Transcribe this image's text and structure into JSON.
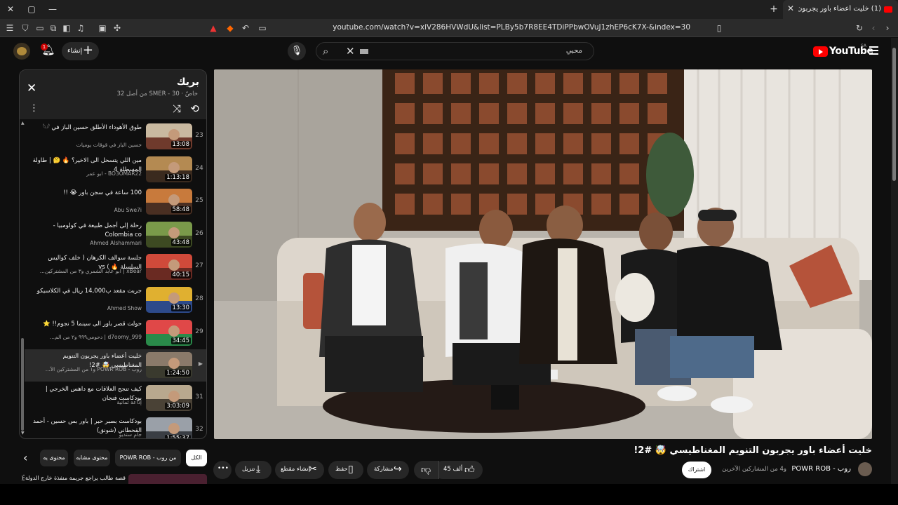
{
  "browser": {
    "tab_title": "(1) خليت أعضاء باور يجربون الت...",
    "tab_badge": "(1)",
    "url": "youtube.com/watch?v=xiV286HVWdU&list=PLBy5b7R8EE4TDiPPbwOVuJ1zhEP6cK7X-&index=30",
    "new_tab": "+",
    "close_tab": "✕",
    "window_controls": [
      "✕",
      "▢",
      "—"
    ]
  },
  "header": {
    "logo_text": "YouTube",
    "logo_country": "SA",
    "search_query": "محبي",
    "create_label": "إنشاء",
    "notification_count": "1"
  },
  "playlist": {
    "title": "بريك",
    "subtitle": "خاصّ · SMER - 30 من أصل 32",
    "items": [
      {
        "num": "23",
        "title": "طوق الأهوداء الأطلق حسين الباز في 𓆩𓆪",
        "channel": "حسين الباز في قوقات يوميات",
        "duration": "13:08",
        "color1": "#c9b9a0",
        "color2": "#6f3a2c"
      },
      {
        "num": "24",
        "title": "مين اللي يتسحل الى الاخير؟ 🔥 🤔 | طاولة المسطلة 4",
        "channel": "BO3OMAR22 - ابو عمر",
        "duration": "1:13:18",
        "color1": "#b48a52",
        "color2": "#3a2a1e"
      },
      {
        "num": "25",
        "title": "100 ساعة في سجن باور 😭 !!",
        "channel": "Abu Swe7i",
        "duration": "58:48",
        "color1": "#c87a3c",
        "color2": "#4a2f22"
      },
      {
        "num": "26",
        "title": "رحلة إلى أجمل طبيعة في كولومبيا - Colombia co",
        "channel": "Ahmed Alshammari",
        "duration": "43:48",
        "color1": "#7a9a4a",
        "color2": "#3d4a22"
      },
      {
        "num": "27",
        "title": "جلسة سوالف الكرهان ( خلف كواليس السلسلة 🔥 ) vs",
        "channel": "xBear | ابو عابد الشمري و٣ من المشتركين...",
        "duration": "40:15",
        "color1": "#d04a3a",
        "color2": "#6a2a22"
      },
      {
        "num": "28",
        "title": "جربت مقعد ب14,000 ريال في الكلاسيكو",
        "channel": "Ahmed Show",
        "duration": "13:30",
        "color1": "#e0b030",
        "color2": "#2d4a8a"
      },
      {
        "num": "29",
        "title": "حولت قصر باور الى سينما 5 نجوم!! ⭐",
        "channel": "d7oomy_999 | دحومي٩٩٩ و٢ من الم...",
        "duration": "34:45",
        "color1": "#e04848",
        "color2": "#2a8a4a"
      },
      {
        "num": "30",
        "title": "خليت أعضاء باور يجربون التنويم المغناطيسي 🤯 #2!",
        "channel": "روب - POWR ROB و١ من المشتركين الآ...",
        "duration": "1:24:50",
        "color1": "#8a7a6a",
        "color2": "#3a3a2e",
        "active": true
      },
      {
        "num": "31",
        "title": "كيف تنجح العلاقات مع داهس الخرجي | بودكاست فنجان",
        "channel": "إذاعة ثمانية",
        "duration": "3:03:09",
        "color1": "#b8a88e",
        "color2": "#4a4236"
      },
      {
        "num": "32",
        "title": "بودكاست بصبر حبر | باور بس حسين - أحمد القحطاني (شونق)",
        "channel": "جام ستديو",
        "duration": "1:55:37",
        "color1": "#9aa0a8",
        "color2": "#3a3e44"
      }
    ]
  },
  "video": {
    "title": "خليت أعضاء باور يجربون التنويم المغناطيسي 🤯 #2!",
    "channel": "روب - POWR ROB",
    "collab": "و4 من المشاركين الآخرين",
    "subscribe_label": "اشتراك",
    "likes": "45 ألف",
    "share_label": "مشاركة",
    "save_label": "حفظ",
    "clip_label": "إنشاء مقطع",
    "download_label": "تنزيل",
    "more_label": "•••"
  },
  "chips": [
    {
      "label": "الكل",
      "selected": true
    },
    {
      "label": "من روب - POWR ROB"
    },
    {
      "label": "محتوى مشابه"
    },
    {
      "label": "محتوى يه"
    }
  ],
  "next_row": {
    "title": "قصة طالب يراجع جريمة منفذة خارج الدولة (",
    "more": "⋮"
  },
  "colors": {
    "accent": "#ff0000",
    "bg": "#0f0f0f",
    "surface": "#272727"
  }
}
